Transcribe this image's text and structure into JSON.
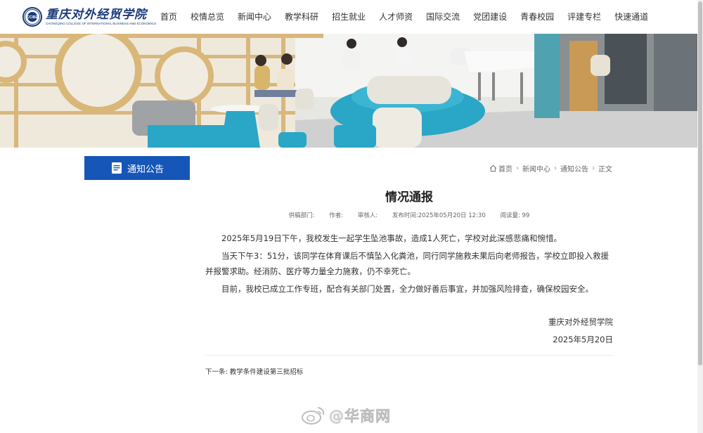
{
  "header": {
    "logo_cn": "重庆对外经贸学院",
    "logo_en": "CHONGQING COLLEGE OF INTERNATIONAL BUSINESS AND ECONOMICS",
    "logo_seal": "CCIBE",
    "nav": [
      "首页",
      "校情总览",
      "新闻中心",
      "教学科研",
      "招生就业",
      "人才师资",
      "国际交流",
      "党团建设",
      "青春校园",
      "评建专栏",
      "快速通道"
    ]
  },
  "sidebar": {
    "title": "通知公告"
  },
  "breadcrumb": [
    "首页",
    "新闻中心",
    "通知公告",
    "正文"
  ],
  "article": {
    "title": "情况通报",
    "meta": {
      "department": "供稿部门:",
      "author": "作者:",
      "reviewer": "审核人:",
      "published": "发布时间:2025年05月20日 12:30",
      "views": "阅读量: 99"
    },
    "paragraphs": [
      "2025年5月19日下午，我校发生一起学生坠池事故，造成1人死亡，学校对此深感悲痛和惋惜。",
      "当天下午3：51分，该同学在体育课后不慎坠入化粪池，同行同学施救未果后向老师报告，学校立即投入救援并报警求助。经消防、医疗等力量全力施救，仍不幸死亡。",
      "目前，我校已成立工作专班，配合有关部门处置，全力做好善后事宜，并加强风险排查，确保校园安全。"
    ],
    "signature_org": "重庆对外经贸学院",
    "signature_date": "2025年5月20日"
  },
  "next_post": {
    "label": "下一条:",
    "title": "教学条件建设第三批招标"
  },
  "watermark": {
    "text": "@华商网"
  },
  "colors": {
    "accent": "#1556b8",
    "brand": "#1a3a7a"
  }
}
